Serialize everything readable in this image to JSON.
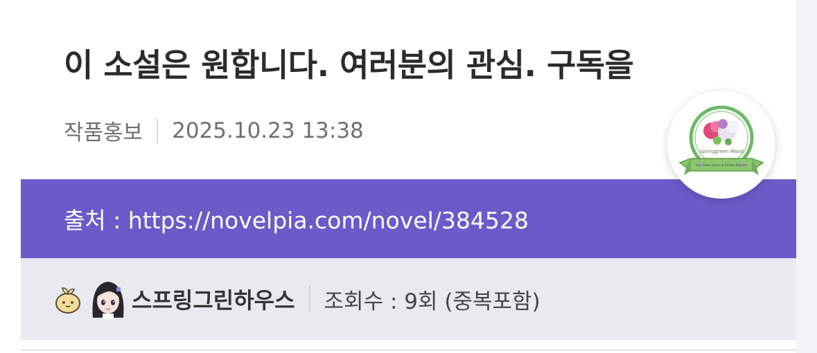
{
  "post": {
    "title": "이 소설은 원합니다. 여러분의 관심. 구독을",
    "category": "작품홍보",
    "datetime": "2025.10.23 13:38"
  },
  "source": {
    "text": "출처 : https://novelpia.com/novel/384528"
  },
  "author": {
    "name": "스프링그린하우스",
    "views": "조회수 : 9회 (중복포함)",
    "level_icon": "sprout-icon",
    "avatar": "anime-girl-avatar"
  },
  "badge": {
    "text_top": "Springgreen Mood",
    "text_ribbon": "Your Green Haven & Garden Beloved",
    "colors": {
      "ring": "#6fb86a",
      "ribbon": "#8cc66f"
    }
  },
  "colors": {
    "source_bar": "#6c5ac9",
    "author_bar": "#e9eaef"
  }
}
